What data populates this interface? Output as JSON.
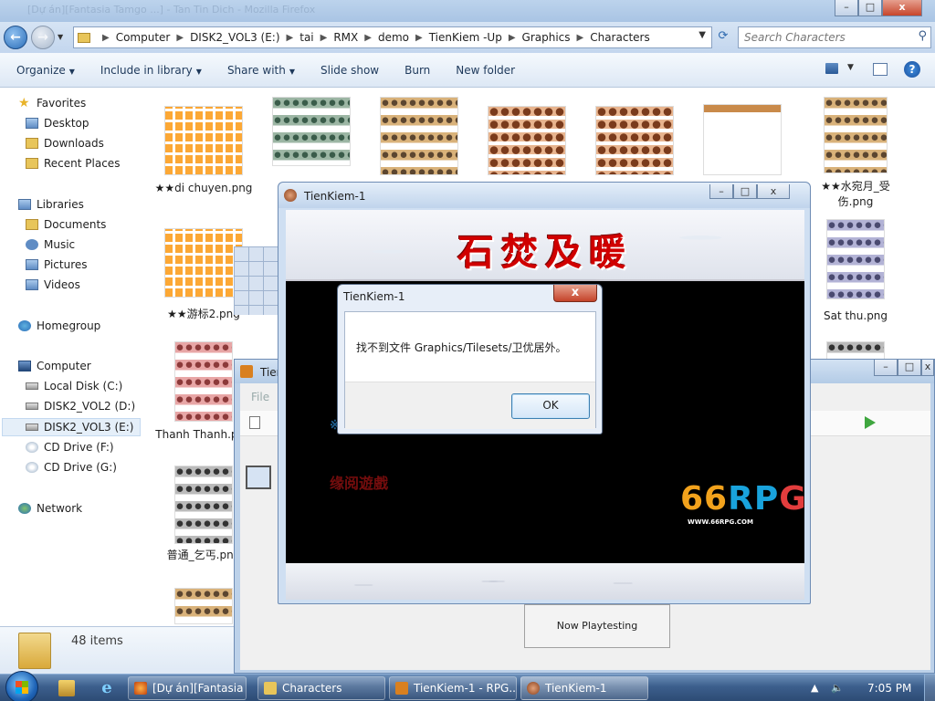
{
  "explorer": {
    "title_blurred": "[Dự án][Fantasia Tamgo ...] - Tan Tin Dich - Mozilla Firefox",
    "breadcrumb": [
      "Computer",
      "DISK2_VOL3 (E:)",
      "tai",
      "RMX",
      "demo",
      "TienKiem -Up",
      "Graphics",
      "Characters"
    ],
    "search_placeholder": "Search Characters",
    "commands": {
      "organize": "Organize",
      "include": "Include in library",
      "share": "Share with",
      "slideshow": "Slide show",
      "burn": "Burn",
      "newfolder": "New folder"
    },
    "nav": {
      "favorites": "Favorites",
      "desktop": "Desktop",
      "downloads": "Downloads",
      "recent": "Recent Places",
      "libraries": "Libraries",
      "documents": "Documents",
      "music": "Music",
      "pictures": "Pictures",
      "videos": "Videos",
      "homegroup": "Homegroup",
      "computer": "Computer",
      "local_c": "Local Disk (C:)",
      "disk_d": "DISK2_VOL2 (D:)",
      "disk_e": "DISK2_VOL3 (E:)",
      "cd_f": "CD Drive (F:)",
      "cd_g": "CD Drive (G:)",
      "network": "Network"
    },
    "files": {
      "f1": "★★di chuyen.png",
      "f7": "★★水宛月_受伤.png",
      "f8": "★★游标2.png",
      "f9": "Sat thu.png",
      "f10": "Thanh Thanh.png",
      "f11": "普通_乞丐.png"
    },
    "item_count": "48 items"
  },
  "rpgmaker": {
    "title": "Tien",
    "menu_file": "File",
    "playtest": "Now Playtesting"
  },
  "game": {
    "title": "TienKiem-1",
    "banner_text": "石焚及暖",
    "subtitle": "缘阅遊戲",
    "logo_a": "66",
    "logo_b": "RP",
    "logo_c": "G",
    "site": "WWW.66RPG.COM"
  },
  "dialog": {
    "title": "TienKiem-1",
    "message": "找不到文件 Graphics/Tilesets/卫优居外。",
    "ok": "OK",
    "close": "x"
  },
  "taskbar": {
    "task1": "[Dự án][Fantasia ...",
    "task2": "Characters",
    "task3": "TienKiem-1 - RPG...",
    "task4": "TienKiem-1",
    "clock": "7:05 PM"
  }
}
